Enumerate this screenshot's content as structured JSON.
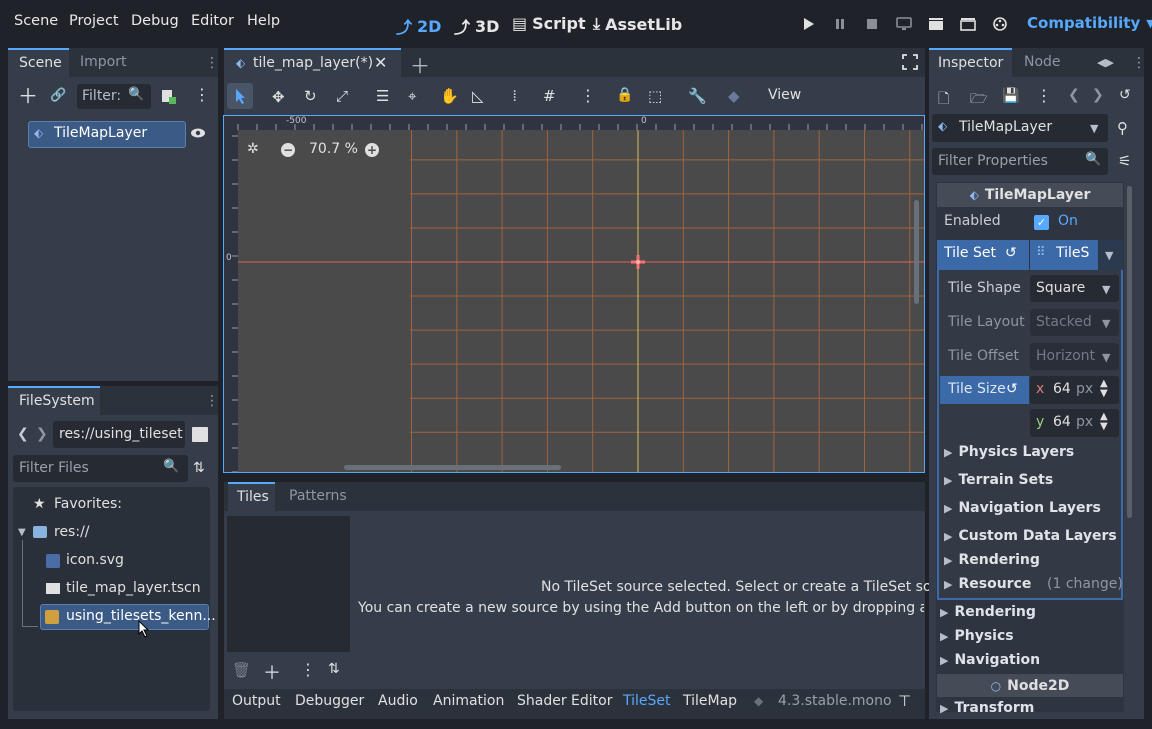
{
  "menu": {
    "items": [
      "Scene",
      "Project",
      "Debug",
      "Editor",
      "Help"
    ]
  },
  "modes": {
    "two_d": "2D",
    "three_d": "3D",
    "script": "Script",
    "assetlib": "AssetLib"
  },
  "renderer": "Compatibility",
  "scene_dock": {
    "tabs": [
      "Scene",
      "Import"
    ],
    "filter_placeholder": "Filter:",
    "root_node": "TileMapLayer"
  },
  "filesystem": {
    "tab": "FileSystem",
    "path": "res://using_tileset",
    "filter_placeholder": "Filter Files",
    "favorites": "Favorites:",
    "root": "res://",
    "files": [
      "icon.svg",
      "tile_map_layer.tscn",
      "using_tilesets_kenn..."
    ]
  },
  "editor_tab": {
    "title": "tile_map_layer(*)"
  },
  "toolbar": {
    "view": "View"
  },
  "viewport": {
    "zoom": "70.7 %",
    "ruler_h": [
      "-500",
      "0"
    ],
    "ruler_v": "0"
  },
  "bottom": {
    "tabs": [
      "Tiles",
      "Patterns"
    ],
    "message_1": "No TileSet source selected. Select or create a TileSet source.",
    "message_2": "You can create a new source by using the Add button on the left or by dropping a tileset",
    "panels": [
      "Output",
      "Debugger",
      "Audio",
      "Animation",
      "Shader Editor",
      "TileSet",
      "TileMap"
    ],
    "version": "4.3.stable.mono"
  },
  "inspector": {
    "tabs": [
      "Inspector",
      "Node"
    ],
    "object": "TileMapLayer",
    "filter_placeholder": "Filter Properties",
    "class_header": "TileMapLayer",
    "enabled_label": "Enabled",
    "enabled_value": "On",
    "tileset_label": "Tile Set",
    "tileset_value": "TileS",
    "tile_shape_label": "Tile Shape",
    "tile_shape_value": "Square",
    "tile_layout_label": "Tile Layout",
    "tile_layout_value": "Stacked",
    "tile_offset_label": "Tile Offset",
    "tile_offset_value": "Horizont",
    "tile_size_label": "Tile Size",
    "tile_size_x_axis": "x",
    "tile_size_x": "64",
    "tile_size_y_axis": "y",
    "tile_size_y": "64",
    "unit": "px",
    "sections_inner": [
      "Physics Layers",
      "Terrain Sets",
      "Navigation Layers",
      "Custom Data Layers",
      "Rendering"
    ],
    "resource_label": "Resource",
    "resource_changes": "(1 change)",
    "sections_outer": [
      "Rendering",
      "Physics",
      "Navigation"
    ],
    "node2d_header": "Node2D",
    "transform": "Transform"
  },
  "colors": {
    "accent": "#57a8ff",
    "selection": "#3c5a86",
    "panel": "#363d4a",
    "viewport": "#4a4a4a"
  }
}
